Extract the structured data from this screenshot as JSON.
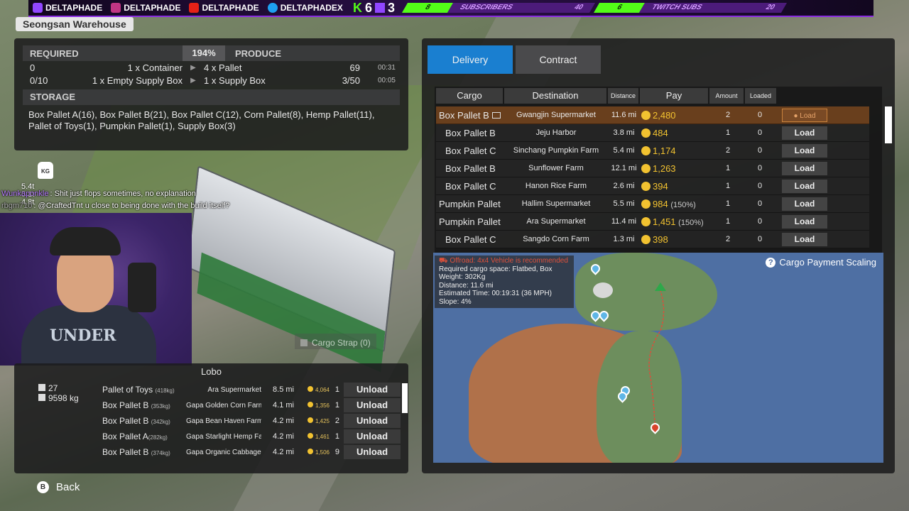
{
  "banner": {
    "twitch": "DELTAPHADE",
    "instagram": "DELTAPHADE",
    "youtube": "DELTAPHADE",
    "twitter": "DELTAPHADEX",
    "kick_count": "6",
    "twitch_count": "3",
    "sub_goal_current": "8",
    "sub_goal_label": "SUBSCRIBERS",
    "sub_goal_target": "40",
    "twitch_goal_current": "6",
    "twitch_goal_label": "TWITCH SUBS",
    "twitch_goal_target": "20"
  },
  "location": "Seongsan Warehouse",
  "production": {
    "required_label": "REQUIRED",
    "ratio": "194%",
    "produce_label": "PRODUCE",
    "rows": [
      {
        "have": "0",
        "req": "1 x Container",
        "prod": "4 x Pallet",
        "stock": "69",
        "time": "00:31"
      },
      {
        "have": "0/10",
        "req": "1 x Empty Supply Box",
        "prod": "1 x Supply Box",
        "stock": "3/50",
        "time": "00:05"
      }
    ],
    "storage_label": "STORAGE",
    "storage_text": "Box Pallet A(16), Box Pallet B(21), Box Pallet C(12), Corn Pallet(8), Hemp Pallet(11), Pallet of Toys(1), Pumpkin Pallet(1), Supply Box(3)"
  },
  "overlay": {
    "kg_label": "KG",
    "weights": [
      "5.4t",
      "5.1t",
      "4.8t"
    ],
    "chat": [
      {
        "user": "Wunkaponkle",
        "msg": ": Shit just flops sometimes, no explanation"
      },
      {
        "user": "rbgm710",
        "msg": ": @CraftedTnt u close to being done with the build itself?"
      }
    ],
    "shirt_text": "UNDER"
  },
  "strap": "Cargo Strap (0)",
  "truck": {
    "name": "Lobo",
    "count": "27",
    "weight": "9598 kg",
    "unload_label": "Unload",
    "items": [
      {
        "name": "Pallet of Toys",
        "kg": "(418kg)",
        "dest": "Ara Supermarket",
        "dist": "8.5 mi",
        "pay": "4,064",
        "amt": "1"
      },
      {
        "name": "Box Pallet B",
        "kg": "(353kg)",
        "dest": "Gapa Golden Corn Farm",
        "dist": "4.1 mi",
        "pay": "1,356",
        "amt": "1"
      },
      {
        "name": "Box Pallet B",
        "kg": "(342kg)",
        "dest": "Gapa Bean Haven Farm",
        "dist": "4.2 mi",
        "pay": "1,425",
        "amt": "2"
      },
      {
        "name": "Box Pallet A",
        "kg": "(282kg)",
        "dest": "Gapa Starlight Hemp Farm",
        "dist": "4.2 mi",
        "pay": "1,461",
        "amt": "1"
      },
      {
        "name": "Box Pallet B",
        "kg": "(374kg)",
        "dest": "Gapa Organic Cabbage Farm",
        "dist": "4.2 mi",
        "pay": "1,506",
        "amt": "9"
      }
    ]
  },
  "back_label": "Back",
  "back_key": "B",
  "delivery": {
    "tabs": [
      "Delivery",
      "Contract"
    ],
    "headers": {
      "cargo": "Cargo",
      "destination": "Destination",
      "distance": "Distance",
      "pay": "Pay",
      "amount": "Amount",
      "loaded": "Loaded"
    },
    "load_label": "Load",
    "rows": [
      {
        "cargo": "Box Pallet B",
        "dest": "Gwangjin Supermarket",
        "dist": "11.6 mi",
        "pay": "2,480",
        "bonus": "",
        "amount": "2",
        "loaded": "0",
        "selected": true
      },
      {
        "cargo": "Box Pallet B",
        "dest": "Jeju Harbor",
        "dist": "3.8 mi",
        "pay": "484",
        "bonus": "",
        "amount": "1",
        "loaded": "0"
      },
      {
        "cargo": "Box Pallet C",
        "dest": "Sinchang Pumpkin Farm",
        "dist": "5.4 mi",
        "pay": "1,174",
        "bonus": "",
        "amount": "2",
        "loaded": "0"
      },
      {
        "cargo": "Box Pallet B",
        "dest": "Sunflower Farm",
        "dist": "12.1 mi",
        "pay": "1,263",
        "bonus": "",
        "amount": "1",
        "loaded": "0"
      },
      {
        "cargo": "Box Pallet C",
        "dest": "Hanon Rice Farm",
        "dist": "2.6 mi",
        "pay": "394",
        "bonus": "",
        "amount": "1",
        "loaded": "0"
      },
      {
        "cargo": "Pumpkin Pallet",
        "dest": "Hallim Supermarket",
        "dist": "5.5 mi",
        "pay": "984",
        "bonus": "(150%)",
        "amount": "1",
        "loaded": "0"
      },
      {
        "cargo": "Pumpkin Pallet",
        "dest": "Ara Supermarket",
        "dist": "11.4 mi",
        "pay": "1,451",
        "bonus": "(150%)",
        "amount": "1",
        "loaded": "0"
      },
      {
        "cargo": "Box Pallet C",
        "dest": "Sangdo Corn Farm",
        "dist": "1.3 mi",
        "pay": "398",
        "bonus": "",
        "amount": "2",
        "loaded": "0"
      }
    ]
  },
  "map": {
    "warning": "Offroad: 4x4 Vehicle is recommended",
    "space": "Required cargo space: Flatbed, Box",
    "weight": "Weight: 302Kg",
    "distance": "Distance: 11.6 mi",
    "time": "Estimated Time: 00:19:31 (36 MPH)",
    "slope": "Slope: 4%",
    "scaling_label": "Cargo Payment Scaling",
    "scaling_icon": "?"
  }
}
